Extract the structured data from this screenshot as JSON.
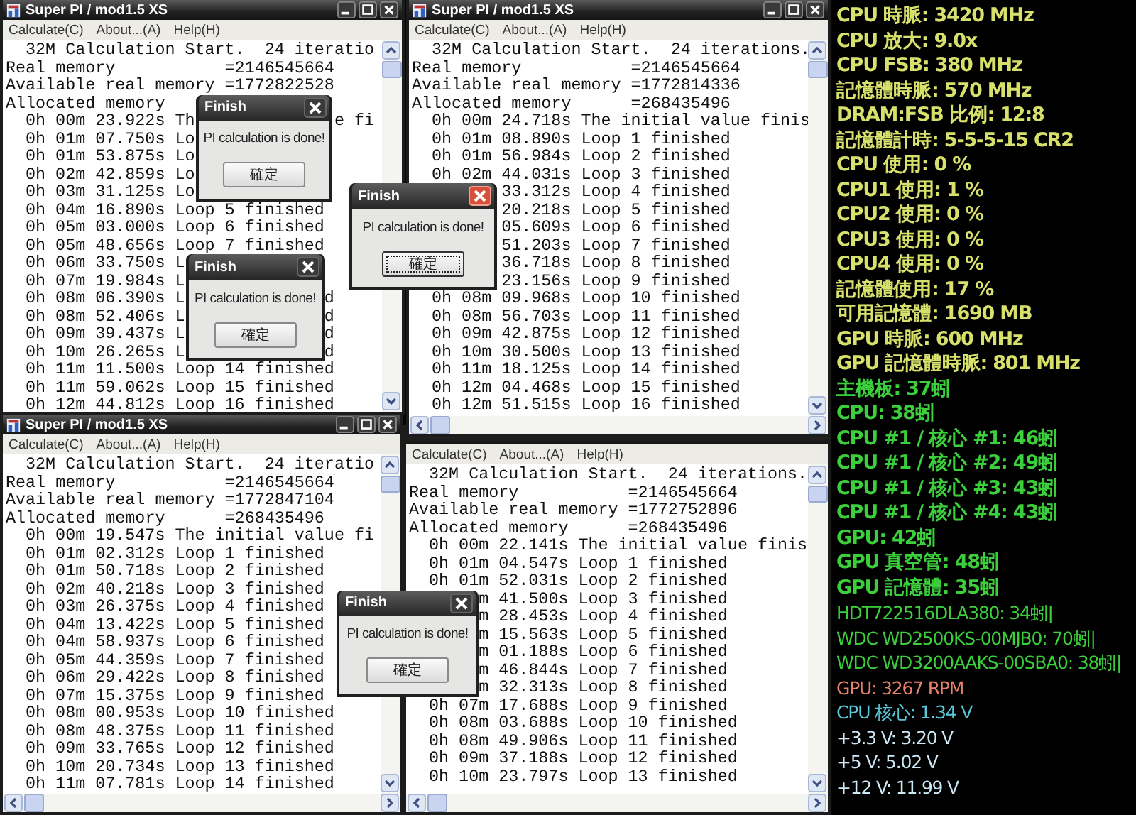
{
  "windows": [
    {
      "title": "Super PI / mod1.5 XS",
      "menu": [
        "Calculate(C)",
        "About...(A)",
        "Help(H)"
      ],
      "lines": [
        "  32M Calculation Start.  24 iteratio",
        "Real memory           =2146545664",
        "Available real memory =1772822528",
        "Allocated memory",
        "  0h 00m 23.922s Th              e fi",
        "  0h 01m 07.750s Lo",
        "  0h 01m 53.875s Lo",
        "  0h 02m 42.859s Lo",
        "  0h 03m 31.125s Lo",
        "  0h 04m 16.890s Loop 5 finished",
        "  0h 05m 03.000s Loop 6 finished",
        "  0h 05m 48.656s Loop 7 finished",
        "  0h 06m 33.750s L",
        "  0h 07m 19.984s L",
        "  0h 08m 06.390s L              d",
        "  0h 08m 52.406s L              d",
        "  0h 09m 39.437s L              d",
        "  0h 10m 26.265s L              d",
        "  0h 11m 11.500s Loop 14 finished",
        "  0h 11m 59.062s Loop 15 finished",
        "  0h 12m 44.812s Loop 16 finished"
      ]
    },
    {
      "title": "Super PI / mod1.5 XS",
      "menu": [
        "Calculate(C)",
        "About...(A)",
        "Help(H)"
      ],
      "lines": [
        "  32M Calculation Start.  24 iterations.",
        "Real memory           =2146545664",
        "Available real memory =1772814336",
        "Allocated memory      =268435496",
        "  0h 00m 24.718s The initial value finis",
        "  0h 01m 08.890s Loop 1 finished",
        "  0h 01m 56.984s Loop 2 finished",
        "  0h 02m 44.031s Loop 3 finished",
        "         33.312s Loop 4 finished",
        "         20.218s Loop 5 finished",
        "         05.609s Loop 6 finished",
        "         51.203s Loop 7 finished",
        "         36.718s Loop 8 finished",
        "         23.156s Loop 9 finished",
        "  0h 08m 09.968s Loop 10 finished",
        "  0h 08m 56.703s Loop 11 finished",
        "  0h 09m 42.875s Loop 12 finished",
        "  0h 10m 30.500s Loop 13 finished",
        "  0h 11m 18.125s Loop 14 finished",
        "  0h 12m 04.468s Loop 15 finished",
        "  0h 12m 51.515s Loop 16 finished"
      ]
    },
    {
      "title": "Super PI / mod1.5 XS",
      "menu": [
        "Calculate(C)",
        "About...(A)",
        "Help(H)"
      ],
      "lines": [
        "  32M Calculation Start.  24 iteratio",
        "Real memory           =2146545664",
        "Available real memory =1772847104",
        "Allocated memory      =268435496",
        "  0h 00m 19.547s The initial value fi",
        "  0h 01m 02.312s Loop 1 finished",
        "  0h 01m 50.718s Loop 2 finished",
        "  0h 02m 40.218s Loop 3 finished",
        "  0h 03m 26.375s Loop 4 finished",
        "  0h 04m 13.422s Loop 5 finished",
        "  0h 04m 58.937s Loop 6 finished",
        "  0h 05m 44.359s Loop 7 finished",
        "  0h 06m 29.422s Loop 8 finished",
        "  0h 07m 15.375s Loop 9 finished",
        "  0h 08m 00.953s Loop 10 finished",
        "  0h 08m 48.375s Loop 11 finished",
        "  0h 09m 33.765s Loop 12 finished",
        "  0h 10m 20.734s Loop 13 finished",
        "  0h 11m 07.781s Loop 14 finished"
      ]
    },
    {
      "menu": [
        "Calculate(C)",
        "About...(A)",
        "Help(H)"
      ],
      "lines": [
        "  32M Calculation Start.  24 iterations.",
        "Real memory           =2146545664",
        "Available real memory =1772752896",
        "Allocated memory      =268435496",
        "  0h 00m 22.141s The initial value finis",
        "  0h 01m 04.547s Loop 1 finished",
        "  0h 01m 52.031s Loop 2 finished",
        "       m 41.500s Loop 3 finished",
        "       m 28.453s Loop 4 finished",
        "       m 15.563s Loop 5 finished",
        "       m 01.188s Loop 6 finished",
        "       m 46.844s Loop 7 finished",
        "       m 32.313s Loop 8 finished",
        "  0h 07m 17.688s Loop 9 finished",
        "  0h 08m 03.688s Loop 10 finished",
        "  0h 08m 49.906s Loop 11 finished",
        "  0h 09m 37.188s Loop 12 finished",
        "  0h 10m 23.797s Loop 13 finished"
      ]
    }
  ],
  "dialogs": [
    {
      "title": "Finish",
      "message": "PI calculation is done!",
      "button": "確定",
      "active": false
    },
    {
      "title": "Finish",
      "message": "PI calculation is done!",
      "button": "確定",
      "active": true
    },
    {
      "title": "Finish",
      "message": "PI calculation is done!",
      "button": "確定",
      "active": false
    },
    {
      "title": "Finish",
      "message": "PI calculation is done!",
      "button": "確定",
      "active": false
    }
  ],
  "monitor": [
    {
      "text": "CPU 時脈: 3420 MHz",
      "kind": "bold",
      "color": "#d8e06c"
    },
    {
      "text": "CPU 放大: 9.0x",
      "kind": "bold",
      "color": "#d8e06c"
    },
    {
      "text": "CPU FSB: 380 MHz",
      "kind": "bold",
      "color": "#d8e06c"
    },
    {
      "text": "記憶體時脈: 570 MHz",
      "kind": "bold",
      "color": "#d8e06c"
    },
    {
      "text": "DRAM:FSB 比例: 12:8",
      "kind": "bold",
      "color": "#d8e06c"
    },
    {
      "text": "記憶體計時: 5-5-5-15 CR2",
      "kind": "bold",
      "color": "#d8e06c"
    },
    {
      "text": "CPU 使用: 0 %",
      "kind": "bold",
      "color": "#d8e06c"
    },
    {
      "text": "CPU1 使用: 1 %",
      "kind": "bold",
      "color": "#d8e06c"
    },
    {
      "text": "CPU2 使用: 0 %",
      "kind": "bold",
      "color": "#d8e06c"
    },
    {
      "text": "CPU3 使用: 0 %",
      "kind": "bold",
      "color": "#d8e06c"
    },
    {
      "text": "CPU4 使用: 0 %",
      "kind": "bold",
      "color": "#d8e06c"
    },
    {
      "text": "記憶體使用: 17 %",
      "kind": "bold",
      "color": "#d8e06c"
    },
    {
      "text": "可用記憶體: 1690 MB",
      "kind": "bold",
      "color": "#d8e06c"
    },
    {
      "text": "GPU 時脈: 600 MHz",
      "kind": "bold",
      "color": "#d8e06c"
    },
    {
      "text": "GPU 記憶體時脈: 801 MHz",
      "kind": "bold",
      "color": "#d8e06c"
    },
    {
      "text": "主機板: 37蚓",
      "kind": "bold",
      "color": "#3ccf3c"
    },
    {
      "text": "CPU: 38蚓",
      "kind": "bold",
      "color": "#3ccf3c"
    },
    {
      "text": "CPU #1 / 核心 #1: 46蚓",
      "kind": "bold",
      "color": "#3ccf3c"
    },
    {
      "text": "CPU #1 / 核心 #2: 49蚓",
      "kind": "bold",
      "color": "#3ccf3c"
    },
    {
      "text": "CPU #1 / 核心 #3: 43蚓",
      "kind": "bold",
      "color": "#3ccf3c"
    },
    {
      "text": "CPU #1 / 核心 #4: 43蚓",
      "kind": "bold",
      "color": "#3ccf3c"
    },
    {
      "text": "GPU: 42蚓",
      "kind": "bold",
      "color": "#3ccf3c"
    },
    {
      "text": "GPU 真空管: 48蚓",
      "kind": "bold",
      "color": "#3ccf3c"
    },
    {
      "text": "GPU 記憶體: 35蚓",
      "kind": "bold",
      "color": "#3ccf3c"
    },
    {
      "text": "HDT722516DLA380: 34蚓|",
      "kind": "plain",
      "color": "#3ccf3c"
    },
    {
      "text": "WDC WD2500KS-00MJB0: 70蚓|",
      "kind": "plain",
      "color": "#3ccf3c"
    },
    {
      "text": "WDC WD3200AAKS-00SBA0: 38蚓|",
      "kind": "plain",
      "color": "#3ccf3c"
    },
    {
      "text": "GPU: 3267 RPM",
      "kind": "plain",
      "color": "#e8806a"
    },
    {
      "text": "CPU 核心: 1.34 V",
      "kind": "plain",
      "color": "#5ac8d8"
    },
    {
      "text": "+3.3 V: 3.20 V",
      "kind": "plain",
      "color": "#cce8f4"
    },
    {
      "text": "+5 V: 5.02 V",
      "kind": "plain",
      "color": "#cce8f4"
    },
    {
      "text": "+12 V: 11.99 V",
      "kind": "plain",
      "color": "#cce8f4"
    }
  ]
}
